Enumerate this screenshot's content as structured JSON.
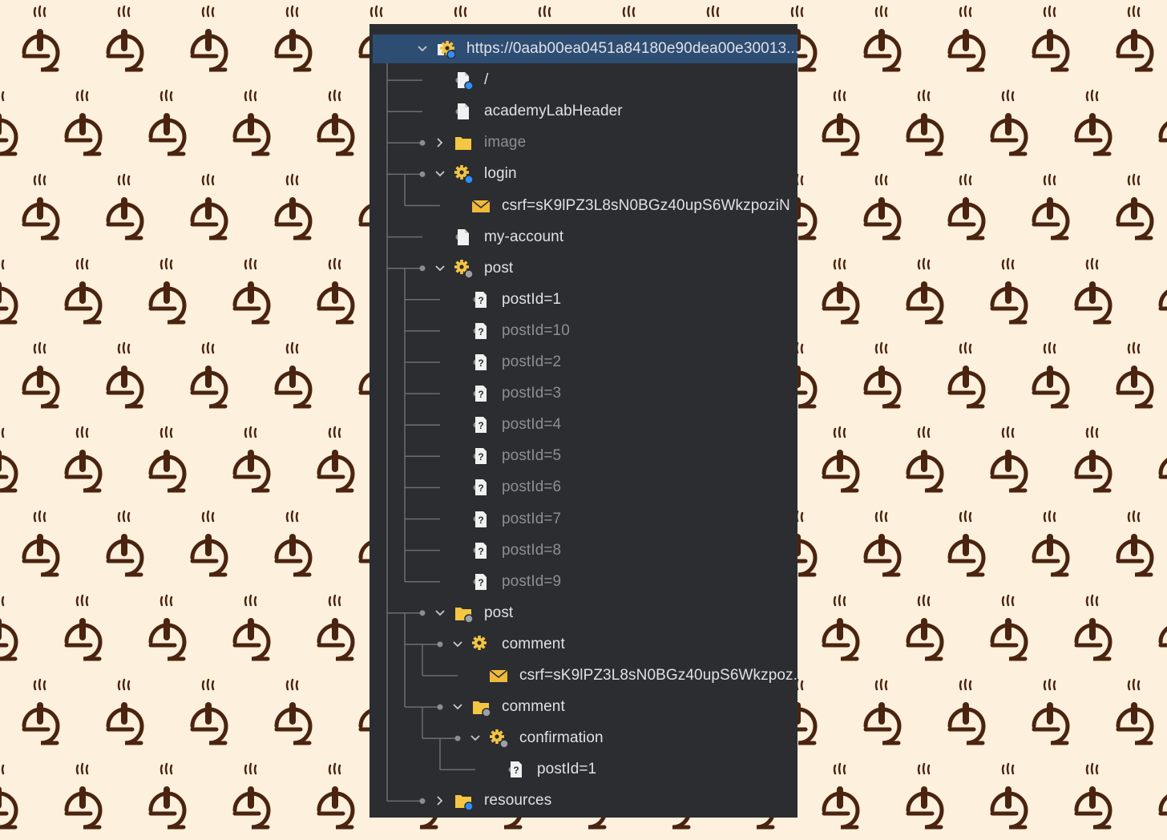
{
  "tree": {
    "rows": [
      {
        "label": "https://0aab00ea0451a84180e90dea00e30013...",
        "icon": "site-globe-icon",
        "level": 0,
        "expander": "expanded",
        "dim": false,
        "selected": true
      },
      {
        "label": "/",
        "icon": "file-info-icon",
        "level": 1,
        "expander": "none",
        "dim": false
      },
      {
        "label": "academyLabHeader",
        "icon": "file-icon",
        "level": 1,
        "expander": "none",
        "dim": false
      },
      {
        "label": "image",
        "icon": "folder-icon",
        "level": 1,
        "expander": "collapsed",
        "dim": true
      },
      {
        "label": "login",
        "icon": "gear-info-icon",
        "level": 1,
        "expander": "expanded",
        "dim": false
      },
      {
        "label": "csrf=sK9lPZ3L8sN0BGz40upS6WkzpoziN",
        "icon": "envelope-icon",
        "level": 2,
        "expander": "none",
        "dim": false
      },
      {
        "label": "my-account",
        "icon": "file-icon",
        "level": 1,
        "expander": "none",
        "dim": false
      },
      {
        "label": "post",
        "icon": "gear-gray-icon",
        "level": 1,
        "expander": "expanded",
        "dim": false
      },
      {
        "label": "postId=1",
        "icon": "unknown-file-icon",
        "level": 2,
        "expander": "none",
        "dim": false
      },
      {
        "label": "postId=10",
        "icon": "unknown-file-icon",
        "level": 2,
        "expander": "none",
        "dim": true
      },
      {
        "label": "postId=2",
        "icon": "unknown-file-icon",
        "level": 2,
        "expander": "none",
        "dim": true
      },
      {
        "label": "postId=3",
        "icon": "unknown-file-icon",
        "level": 2,
        "expander": "none",
        "dim": true
      },
      {
        "label": "postId=4",
        "icon": "unknown-file-icon",
        "level": 2,
        "expander": "none",
        "dim": true
      },
      {
        "label": "postId=5",
        "icon": "unknown-file-icon",
        "level": 2,
        "expander": "none",
        "dim": true
      },
      {
        "label": "postId=6",
        "icon": "unknown-file-icon",
        "level": 2,
        "expander": "none",
        "dim": true
      },
      {
        "label": "postId=7",
        "icon": "unknown-file-icon",
        "level": 2,
        "expander": "none",
        "dim": true
      },
      {
        "label": "postId=8",
        "icon": "unknown-file-icon",
        "level": 2,
        "expander": "none",
        "dim": true
      },
      {
        "label": "postId=9",
        "icon": "unknown-file-icon",
        "level": 2,
        "expander": "none",
        "dim": true
      },
      {
        "label": "post",
        "icon": "folder-gray-icon",
        "level": 1,
        "expander": "expanded",
        "dim": false
      },
      {
        "label": "comment",
        "icon": "gear-icon",
        "level": 2,
        "expander": "expanded",
        "dim": false
      },
      {
        "label": "csrf=sK9lPZ3L8sN0BGz40upS6Wkzpoz...",
        "icon": "envelope-icon",
        "level": 3,
        "expander": "none",
        "dim": false
      },
      {
        "label": "comment",
        "icon": "folder-gray-icon",
        "level": 2,
        "expander": "expanded",
        "dim": false
      },
      {
        "label": "confirmation",
        "icon": "gear-gray-icon",
        "level": 3,
        "expander": "expanded",
        "dim": false
      },
      {
        "label": "postId=1",
        "icon": "unknown-file-icon",
        "level": 4,
        "expander": "none",
        "dim": false
      },
      {
        "label": "resources",
        "icon": "folder-info-icon",
        "level": 1,
        "expander": "collapsed",
        "dim": false
      }
    ]
  },
  "colors": {
    "panel_bg": "#2b2d30",
    "selected_bg": "#2e4d73",
    "text": "#dfe1e5",
    "text_dim": "#8c8f94",
    "folder": "#f5c542",
    "envelope": "#f0b93a",
    "info_badge": "#2f8fff",
    "wallpaper_bg": "#fdf0dc",
    "wallpaper_icon": "#4a2410"
  }
}
